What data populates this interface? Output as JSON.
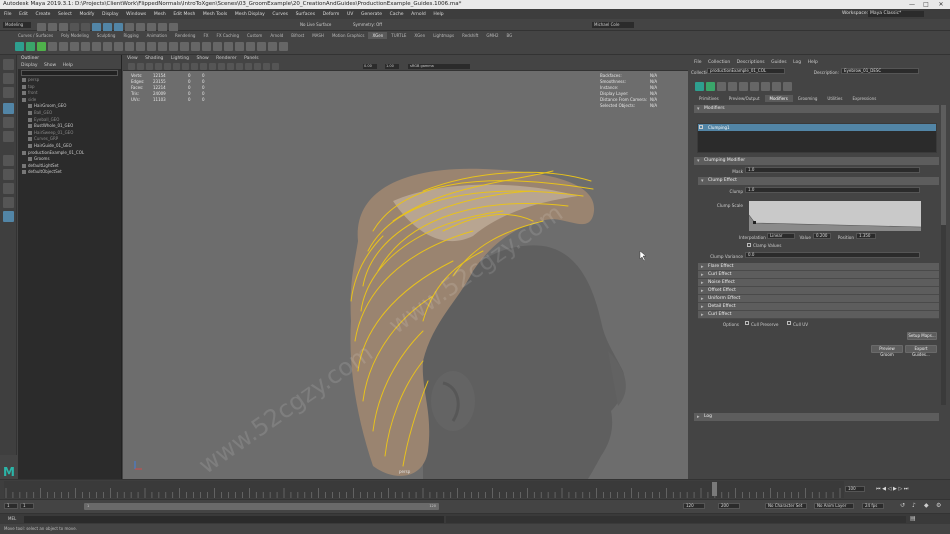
{
  "window": {
    "title": "Autodesk Maya 2019.3.1: D:\\Projects\\ClientWork\\FlippedNormals\\IntroToXgen\\Scenes\\03_GroomExample\\20_CreationAndGuides\\ProductionExample_Guides.1006.ma*",
    "workspace_label": "Workspace:",
    "workspace_value": "Maya Classic*"
  },
  "menubar": [
    "File",
    "Edit",
    "Create",
    "Select",
    "Modify",
    "Display",
    "Windows",
    "Mesh",
    "Edit Mesh",
    "Mesh Tools",
    "Mesh Display",
    "Curves",
    "Surfaces",
    "Deform",
    "UV",
    "Generate",
    "Cache",
    "Arnold",
    "Help"
  ],
  "statusline": {
    "mode": "Modeling",
    "no_live_surface": "No Live Surface",
    "symmetry": "Symmetry: Off",
    "sign_in": "Michael Cole"
  },
  "shelf": {
    "tabs": [
      "Curves / Surfaces",
      "Poly Modeling",
      "Sculpting",
      "Rigging",
      "Animation",
      "Rendering",
      "FX",
      "FX Caching",
      "Custom",
      "Arnold",
      "Bifrost",
      "MASH",
      "Motion Graphics",
      "XGen",
      "TURTLE",
      "XGen",
      "Lightmaps",
      "Redshift",
      "GMH2",
      "BG"
    ],
    "active_tab": "XGen"
  },
  "outliner": {
    "title": "Outliner",
    "menu": [
      "Display",
      "Show",
      "Help"
    ],
    "items": [
      {
        "label": "persp",
        "dim": true,
        "indent": 0
      },
      {
        "label": "top",
        "dim": true,
        "indent": 0
      },
      {
        "label": "front",
        "dim": true,
        "indent": 0
      },
      {
        "label": "side",
        "dim": true,
        "indent": 0
      },
      {
        "label": "HairGroom_GEO",
        "dim": false,
        "indent": 1
      },
      {
        "label": "Ball_GEO",
        "dim": true,
        "indent": 1
      },
      {
        "label": "Eyeball_GEO",
        "dim": true,
        "indent": 1
      },
      {
        "label": "BustWhole_01_GEO",
        "dim": false,
        "indent": 1
      },
      {
        "label": "HairSweep_01_GEO",
        "dim": true,
        "indent": 1
      },
      {
        "label": "Curves_GRP",
        "dim": true,
        "indent": 1
      },
      {
        "label": "HairGuide_01_GEO",
        "dim": false,
        "indent": 1
      },
      {
        "label": "productionExample_01_COL",
        "dim": false,
        "indent": 0
      },
      {
        "label": "Grooms",
        "dim": false,
        "indent": 1
      },
      {
        "label": "defaultLightSet",
        "dim": false,
        "indent": 0
      },
      {
        "label": "defaultObjectSet",
        "dim": false,
        "indent": 0
      }
    ]
  },
  "viewport": {
    "menu": [
      "View",
      "Shading",
      "Lighting",
      "Show",
      "Renderer",
      "Panels"
    ],
    "toolbar_values": {
      "near": "0.00",
      "far": "1.00",
      "colorspace": "sRGB gamma"
    },
    "hud_left": [
      {
        "label": "Verts:",
        "a": "12154",
        "b": "0",
        "c": "0"
      },
      {
        "label": "Edges:",
        "a": "23155",
        "b": "0",
        "c": "0"
      },
      {
        "label": "Faces:",
        "a": "12214",
        "b": "0",
        "c": "0"
      },
      {
        "label": "Tris:",
        "a": "24009",
        "b": "0",
        "c": "0"
      },
      {
        "label": "UVs:",
        "a": "11103",
        "b": "0",
        "c": "0"
      }
    ],
    "hud_right": [
      {
        "label": "Backfaces:",
        "value": "N/A"
      },
      {
        "label": "Smoothness:",
        "value": "N/A"
      },
      {
        "label": "Instance:",
        "value": "N/A"
      },
      {
        "label": "Display Layer:",
        "value": "N/A"
      },
      {
        "label": "Distance From Camera:",
        "value": "N/A"
      },
      {
        "label": "Selected Objects:",
        "value": "N/A"
      }
    ],
    "camera_label": "persp",
    "colors": {
      "background": "#6d6d6d",
      "head": "#5f5f5f",
      "hair": "#9a8470",
      "guides": "#e8c21c"
    }
  },
  "attribute_editor": {
    "menu": [
      "File",
      "Collection",
      "Descriptions",
      "Guides",
      "Log",
      "Help"
    ],
    "collection_label": "Collection:",
    "collection_value": "productionExample_01_COL",
    "description_label": "Description:",
    "description_value": "Eyebrow_01_DESC",
    "tabs": [
      "Primitives",
      "Preview/Output",
      "Modifiers",
      "Grooming",
      "Utilities",
      "Expressions"
    ],
    "active_tab": "Modifiers",
    "modifiers_label": "Modifiers",
    "modifier_item": "Clumping1",
    "sections": {
      "clumping_modifier": "Clumping Modifier",
      "mask_label": "Mask",
      "mask_value": "1.0",
      "clump_effect": "Clump Effect",
      "clump_label": "Clump",
      "clump_value": "1.0",
      "clump_scale_label": "Clump Scale",
      "interpolation_label": "Interpolation",
      "interpolation_value": "Linear",
      "value_label": "Value",
      "value_value": "0.200",
      "position_label": "Position",
      "position_value": "1.350",
      "clamp_values_label": "Clamp Values",
      "clump_variance_label": "Clump Variance",
      "clump_variance_value": "0.0",
      "collapsed": [
        "Flare Effect",
        "Curl Effect",
        "Noise Effect",
        "Offset Effect",
        "Uniform Effect",
        "Detail Effect",
        "Curl Effect"
      ],
      "options_label": "Options",
      "check_preserve": "Cull Preserve",
      "check_uv": "Cull UV",
      "setup_maps": "Setup Maps...",
      "preview_groom": "Preview Groom",
      "export_guides": "Export Guides...",
      "log_label": "Log"
    }
  },
  "timeslider": {
    "current_frame": "100",
    "start": "1",
    "end": "120",
    "range_start": "1",
    "range_end": "120",
    "anim_start": "120",
    "anim_end": "200",
    "char_set": "No Character Set",
    "anim_layer": "No Anim Layer",
    "fps": "24 fps"
  },
  "cmdline": {
    "label": "MEL"
  },
  "helpline": {
    "text": "Move tool: select an object to move."
  }
}
